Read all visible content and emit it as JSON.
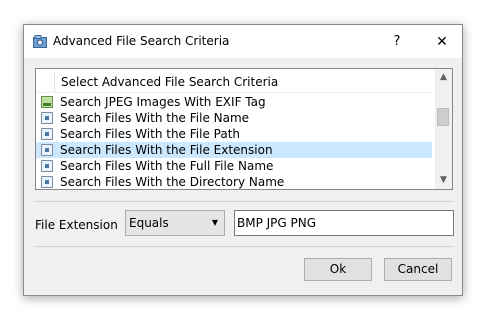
{
  "window": {
    "title": "Advanced File Search Criteria",
    "help_label": "?",
    "close_label": "✕"
  },
  "criteria_list": {
    "header": "Select Advanced File Search Criteria",
    "items": [
      {
        "label": "Search JPEG Images With EXIF Tag",
        "icon": "image-icon",
        "selected": false
      },
      {
        "label": "Search Files With the File Name",
        "icon": "file-criteria-icon",
        "selected": false
      },
      {
        "label": "Search Files With the File Path",
        "icon": "file-criteria-icon",
        "selected": false
      },
      {
        "label": "Search Files With the File Extension",
        "icon": "file-criteria-icon",
        "selected": true
      },
      {
        "label": "Search Files With the Full File Name",
        "icon": "file-criteria-icon",
        "selected": false
      },
      {
        "label": "Search Files With the Directory Name",
        "icon": "file-criteria-icon",
        "selected": false
      }
    ],
    "scroll_up": "▲",
    "scroll_down": "▼"
  },
  "filter": {
    "label": "File Extension",
    "operator": "Equals",
    "operator_arrow": "▼",
    "value": "BMP JPG PNG"
  },
  "buttons": {
    "ok": "Ok",
    "cancel": "Cancel"
  },
  "colors": {
    "selection": "#cce8ff",
    "window_bg": "#f0f0f0"
  }
}
